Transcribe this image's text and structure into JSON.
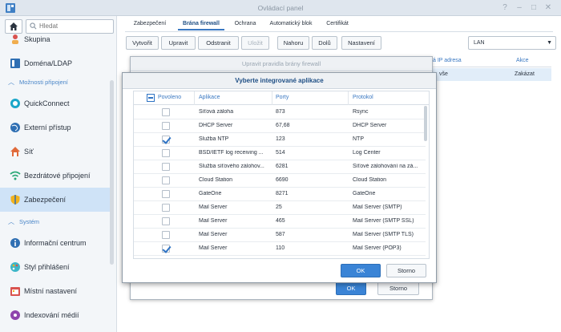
{
  "window": {
    "title": "Ovládací panel"
  },
  "sidebar": {
    "search_placeholder": "Hledat",
    "items": [
      {
        "label": "Skupina",
        "icon": "group-icon"
      },
      {
        "label": "Doména/LDAP",
        "icon": "domain-icon"
      },
      {
        "section": "Možnosti připojení"
      },
      {
        "label": "QuickConnect",
        "icon": "quickconnect-icon"
      },
      {
        "label": "Externí přístup",
        "icon": "globe-icon"
      },
      {
        "label": "Síť",
        "icon": "network-icon"
      },
      {
        "label": "Bezdrátové připojení",
        "icon": "wifi-icon"
      },
      {
        "label": "Zabezpečení",
        "icon": "shield-icon"
      },
      {
        "section": "Systém"
      },
      {
        "label": "Informační centrum",
        "icon": "info-icon"
      },
      {
        "label": "Styl přihlášení",
        "icon": "palette-icon"
      },
      {
        "label": "Místní nastavení",
        "icon": "regional-icon"
      },
      {
        "label": "Indexování médií",
        "icon": "media-index-icon"
      }
    ]
  },
  "tabs": [
    "Zabezpečení",
    "Brána firewall",
    "Ochrana",
    "Automatický blok",
    "Certifikát"
  ],
  "toolbar": {
    "create": "Vytvořit",
    "edit": "Upravit",
    "delete": "Odstranit",
    "save": "Uložit",
    "up": "Nahoru",
    "down": "Dolů",
    "settings": "Nastavení",
    "interface": "LAN"
  },
  "background_table": {
    "headers": [
      "á IP adresa",
      "Akce"
    ],
    "row": [
      "vše",
      "Zakázat"
    ]
  },
  "outer_dialog": {
    "title": "Upravit pravidla brány firewall",
    "ok": "OK",
    "cancel": "Storno"
  },
  "inner_dialog": {
    "title": "Vyberte integrované aplikace",
    "columns": [
      "Povoleno",
      "Aplikace",
      "Porty",
      "Protokol"
    ],
    "rows": [
      {
        "checked": false,
        "app": "Síťová záloha",
        "ports": "873",
        "protocol": "Rsync"
      },
      {
        "checked": false,
        "app": "DHCP Server",
        "ports": "67,68",
        "protocol": "DHCP Server"
      },
      {
        "checked": true,
        "app": "Služba NTP",
        "ports": "123",
        "protocol": "NTP"
      },
      {
        "checked": false,
        "app": "BSD/IETF log receiving ...",
        "ports": "514",
        "protocol": "Log Center"
      },
      {
        "checked": false,
        "app": "Služba síťového zálohov...",
        "ports": "6281",
        "protocol": "Síťové zálohování na zá..."
      },
      {
        "checked": false,
        "app": "Cloud Station",
        "ports": "6690",
        "protocol": "Cloud Station"
      },
      {
        "checked": false,
        "app": "GateOne",
        "ports": "8271",
        "protocol": "GateOne"
      },
      {
        "checked": false,
        "app": "Mail Server",
        "ports": "25",
        "protocol": "Mail Server (SMTP)"
      },
      {
        "checked": false,
        "app": "Mail Server",
        "ports": "465",
        "protocol": "Mail Server (SMTP SSL)"
      },
      {
        "checked": false,
        "app": "Mail Server",
        "ports": "587",
        "protocol": "Mail Server (SMTP TLS)"
      },
      {
        "checked": true,
        "app": "Mail Server",
        "ports": "110",
        "protocol": "Mail Server (POP3)"
      }
    ],
    "ok": "OK",
    "cancel": "Storno"
  },
  "colors": {
    "accent": "#3a84d6",
    "active_item": "#cfe3f7",
    "link": "#3a78c2"
  }
}
